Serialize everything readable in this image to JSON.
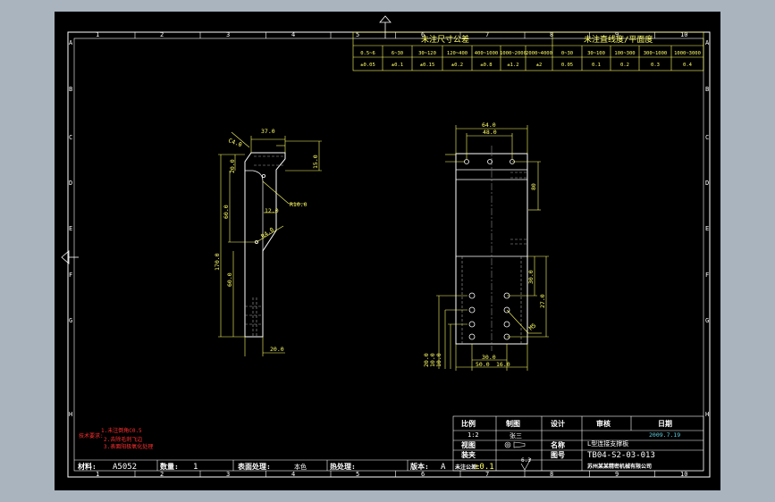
{
  "sheet": {
    "col_labels": [
      "1",
      "2",
      "3",
      "4",
      "5",
      "6",
      "7",
      "8",
      "9",
      "10"
    ],
    "row_labels": [
      "A",
      "B",
      "C",
      "D",
      "E",
      "F",
      "G",
      "H"
    ]
  },
  "tolerance_table": {
    "title_left": "未注尺寸公差",
    "title_right": "未注直线度/平面度",
    "ranges": [
      "0.5~6",
      "6~30",
      "30~120",
      "120~400",
      "400~1000",
      "1000~2000",
      "2000~4000",
      "0~30",
      "30~100",
      "100~300",
      "300~1000",
      "1000~3000"
    ],
    "values": [
      "±0.05",
      "±0.1",
      "±0.15",
      "±0.2",
      "±0.8",
      "±1.2",
      "±2",
      "0.05",
      "0.1",
      "0.2",
      "0.3",
      "0.4"
    ]
  },
  "left_view_dims": {
    "d1": "37.0",
    "d2": "C4.0",
    "d3": "20.0",
    "d4": "15.0",
    "d5": "R10.0",
    "d6": "12.0",
    "d7": "60.0",
    "d8": "R4.0",
    "d9": "170.0",
    "d10": "60.0",
    "d11": "20.0"
  },
  "right_view_dims": {
    "d1": "64.0",
    "d2": "48.0",
    "d3": "80",
    "d4": "30.0",
    "d5": "27.0",
    "d6": "M5",
    "d7": "30.0",
    "d8": "50.0",
    "d9": "16.0",
    "d10": "20.0",
    "d11": "10.0",
    "d12": "10.0"
  },
  "notes": {
    "title": "技术要求:",
    "line1": "1.未注倒角C0.5",
    "line2": "2.去除毛刺飞边",
    "line3": "3.表面阳极氧化处理"
  },
  "title_block": {
    "scale_label": "比例",
    "scale_value": "1:2",
    "drawn_label": "制图",
    "drawn_value": "张三",
    "design_label": "设计",
    "check_label": "审核",
    "date_label": "日期",
    "date_value": "2009.7.19",
    "projection_label": "视图",
    "name_label": "名称",
    "name_value": "L型连接支撑板",
    "fixture_label": "装夹",
    "drawing_no_label": "图号",
    "drawing_no_value": "TB04-S2-03-013",
    "material_label": "材料:",
    "material_value": "A5052",
    "qty_label": "数量:",
    "qty_value": "1",
    "surface_label": "表面处理:",
    "surface_value": "本色",
    "heat_label": "热处理:",
    "version_label": "版本:",
    "version_value": "A",
    "tol_label": "未注公差",
    "tol_value": "±0.1",
    "rough_value": "6.3",
    "company": "苏州某某精密机械有限公司"
  },
  "colors": {
    "border": "#ffffff",
    "geometry": "#ffffff",
    "dimension": "#ffff66",
    "note": "#ff3030",
    "highlight": "#60d0e0",
    "frame": "#a9b4bf"
  }
}
